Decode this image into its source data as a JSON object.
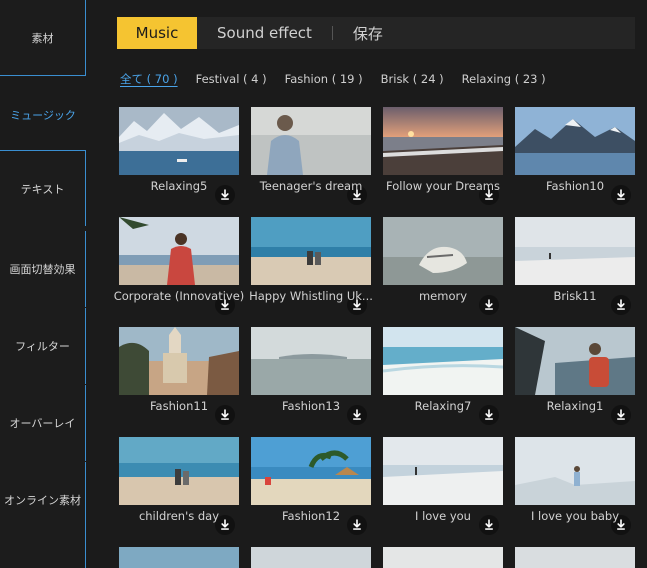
{
  "sidebar": {
    "items": [
      {
        "label": "素材"
      },
      {
        "label": "ミュージック"
      },
      {
        "label": "テキスト"
      },
      {
        "label": "画面切替効果"
      },
      {
        "label": "フィルター"
      },
      {
        "label": "オーバーレイ"
      },
      {
        "label": "オンライン素材"
      }
    ]
  },
  "tabs": [
    {
      "label": "Music"
    },
    {
      "label": "Sound effect"
    },
    {
      "label": "保存"
    }
  ],
  "filters": [
    {
      "label": "全て ( 70 )"
    },
    {
      "label": "Festival ( 4 )"
    },
    {
      "label": "Fashion ( 19 )"
    },
    {
      "label": "Brisk ( 24 )"
    },
    {
      "label": "Relaxing ( 23 )"
    }
  ],
  "tracks": [
    {
      "title": "Relaxing5"
    },
    {
      "title": "Teenager's dream"
    },
    {
      "title": "Follow your Dreams"
    },
    {
      "title": "Fashion10"
    },
    {
      "title": "Corporate (Innovative)"
    },
    {
      "title": "Happy Whistling Uk..."
    },
    {
      "title": "memory"
    },
    {
      "title": "Brisk11"
    },
    {
      "title": "Fashion11"
    },
    {
      "title": "Fashion13"
    },
    {
      "title": "Relaxing7"
    },
    {
      "title": "Relaxing1"
    },
    {
      "title": "children's day"
    },
    {
      "title": "Fashion12"
    },
    {
      "title": "I love you"
    },
    {
      "title": "I love you baby"
    }
  ],
  "colors": {
    "accent_tab": "#f5c431",
    "accent_blue": "#4aa3e8",
    "background": "#1b1b1b"
  }
}
